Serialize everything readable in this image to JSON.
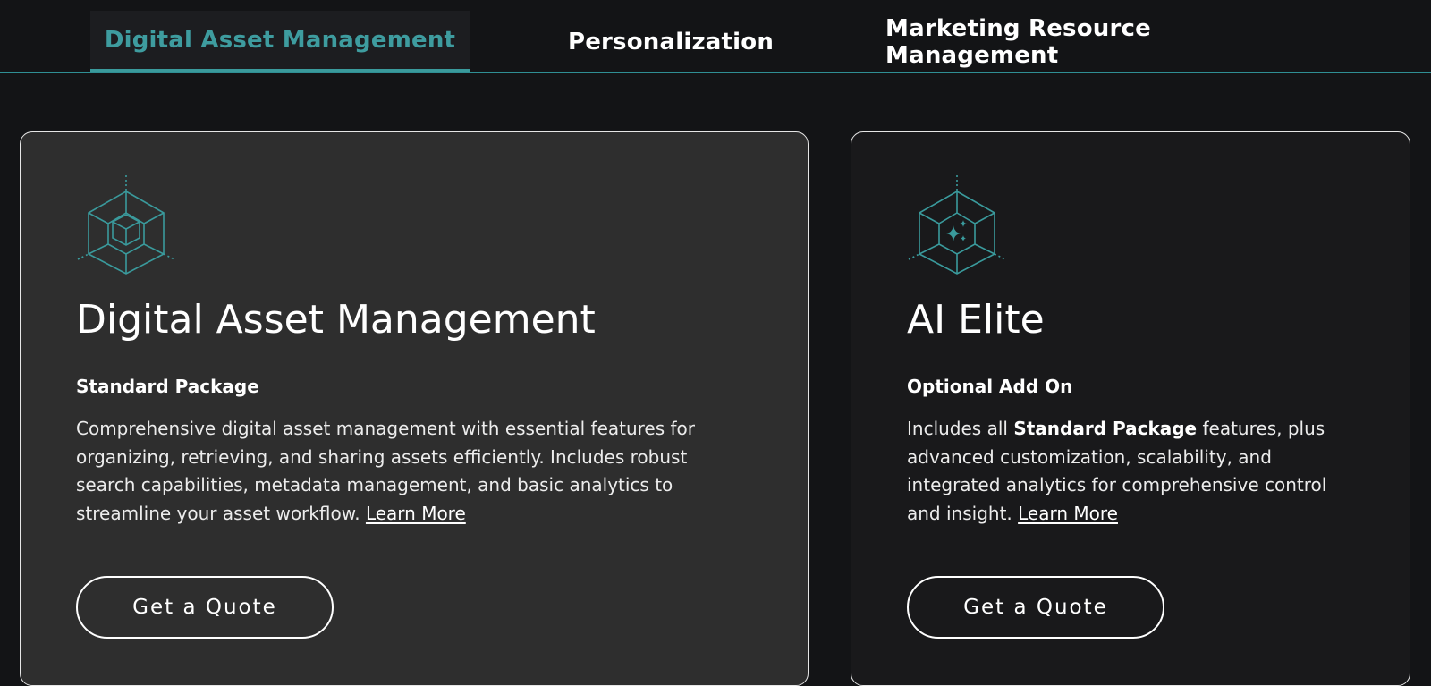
{
  "tabs": [
    {
      "label": "Digital Asset Management",
      "active": true
    },
    {
      "label": "Personalization",
      "active": false
    },
    {
      "label": "Marketing Resource Management",
      "active": false
    }
  ],
  "accent_color": "#3e9c9f",
  "cards": [
    {
      "icon": "cube-icon",
      "title": "Digital Asset Management",
      "subtitle": "Standard Package",
      "description": "Comprehensive digital asset management with essential features for organizing, retrieving, and sharing assets efficiently. Includes robust search capabilities, metadata management, and basic analytics to streamline your asset workflow.",
      "learn_more": "Learn More",
      "button": "Get a Quote"
    },
    {
      "icon": "ai-sparkle-cube-icon",
      "title": "AI Elite",
      "subtitle": "Optional Add On",
      "description_pre": "Includes all",
      "description_bold": "Standard Package",
      "description_post": "features, plus advanced customization, scalability, and integrated analytics for comprehensive control and insight.",
      "learn_more": "Learn More",
      "button": "Get a Quote"
    }
  ]
}
